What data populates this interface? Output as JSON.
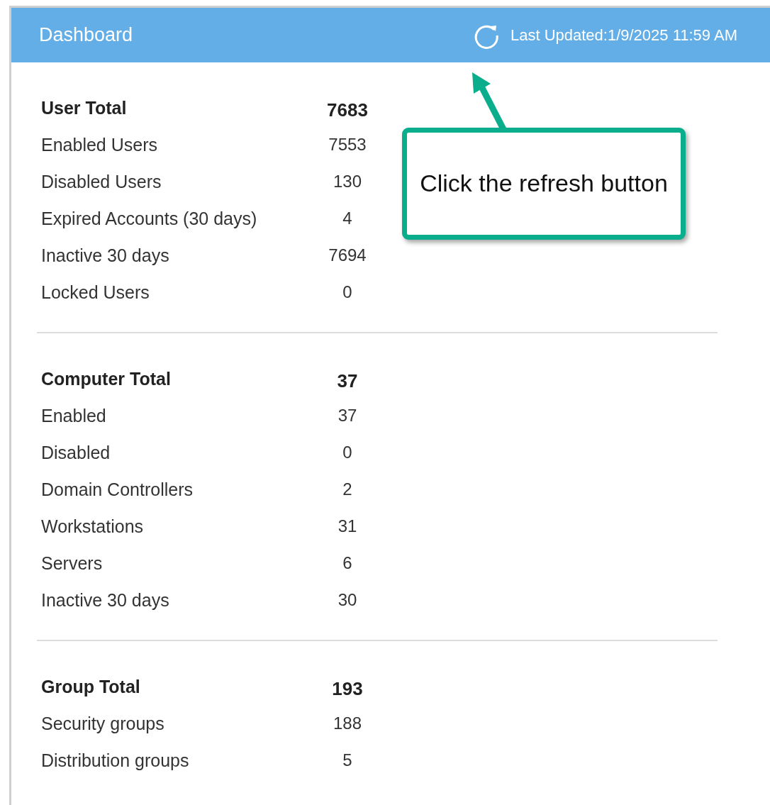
{
  "header": {
    "title": "Dashboard",
    "last_updated": "Last Updated:1/9/2025 11:59 AM"
  },
  "sections": [
    {
      "title": "User Total",
      "total": "7683",
      "rows": [
        {
          "label": "Enabled Users",
          "value": "7553"
        },
        {
          "label": "Disabled Users",
          "value": "130"
        },
        {
          "label": "Expired Accounts (30 days)",
          "value": "4"
        },
        {
          "label": "Inactive 30 days",
          "value": "7694"
        },
        {
          "label": "Locked Users",
          "value": "0"
        }
      ]
    },
    {
      "title": "Computer Total",
      "total": "37",
      "rows": [
        {
          "label": "Enabled",
          "value": "37"
        },
        {
          "label": "Disabled",
          "value": "0"
        },
        {
          "label": "Domain Controllers",
          "value": "2"
        },
        {
          "label": "Workstations",
          "value": "31"
        },
        {
          "label": "Servers",
          "value": "6"
        },
        {
          "label": "Inactive 30 days",
          "value": "30"
        }
      ]
    },
    {
      "title": "Group Total",
      "total": "193",
      "rows": [
        {
          "label": "Security groups",
          "value": "188"
        },
        {
          "label": "Distribution groups",
          "value": "5"
        }
      ]
    }
  ],
  "callout": {
    "text": "Click the refresh button"
  }
}
